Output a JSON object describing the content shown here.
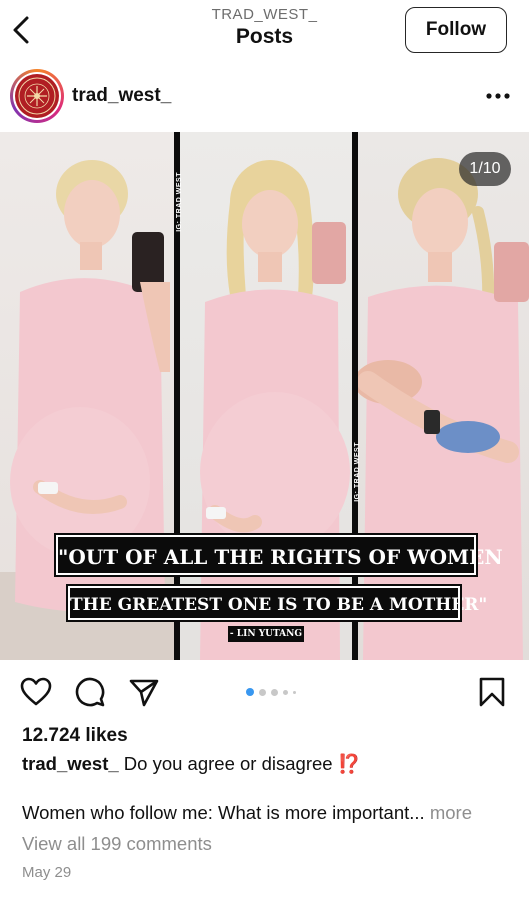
{
  "nav": {
    "subtitle": "TRAD_WEST_",
    "title": "Posts",
    "follow_label": "Follow"
  },
  "post": {
    "username": "trad_west_",
    "counter": "1/10",
    "image": {
      "quote_line1": "\"OUT OF ALL THE RIGHTS OF WOMEN",
      "quote_line2": "THE GREATEST ONE IS TO BE A MOTHER\"",
      "attribution": "- LIN YUTANG",
      "watermark": "IG: TRAD WEST"
    },
    "carousel": {
      "total_dots": 5,
      "active_index": 0
    },
    "likes": "12.724 likes",
    "caption_user": "trad_west_",
    "caption_text": "Do you agree or disagree",
    "caption_emoji": "⁉️",
    "caption_line2": "Women who follow me: What is more important...",
    "more_label": "more",
    "comments_label": "View all 199 comments",
    "date": "May 29"
  },
  "icons": {
    "back": "chevron-left-icon",
    "more": "more-horizontal-icon",
    "like": "heart-icon",
    "comment": "comment-icon",
    "share": "send-icon",
    "save": "bookmark-icon"
  },
  "colors": {
    "accent_blue": "#3897f0",
    "muted_text": "#8e8e8e",
    "logo_red": "#b01e23"
  }
}
